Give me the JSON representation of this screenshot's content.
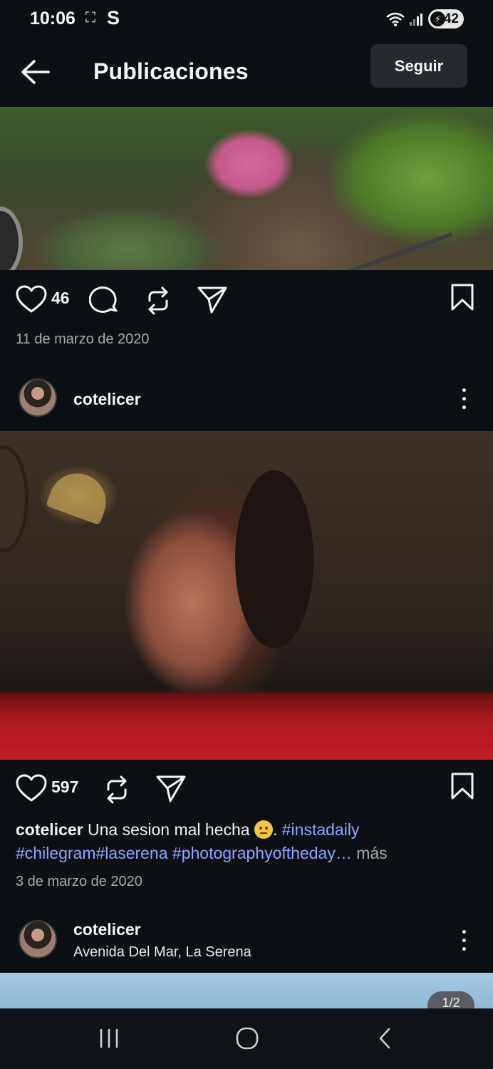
{
  "status_bar": {
    "time": "10:06",
    "screen_icon": "screen-record-icon",
    "app_icon_label": "S",
    "battery": "42"
  },
  "header": {
    "title": "Publicaciones",
    "follow_label": "Seguir"
  },
  "posts": [
    {
      "likes": "46",
      "date": "11 de marzo de 2020"
    },
    {
      "username": "cotelicer",
      "likes": "597",
      "caption_user": "cotelicer",
      "caption_text": "Una sesion mal hecha",
      "caption_after_emoji": ".",
      "tags_line1": "#instadaily",
      "tags_line2": "#chilegram#laserena #photographyoftheday…",
      "more_label": "más",
      "date": "3 de marzo de 2020"
    },
    {
      "username": "cotelicer",
      "location": "Avenida Del Mar, La Serena",
      "image_counter": "1/2"
    }
  ],
  "colors": {
    "background": "#0c1014",
    "hashtag": "#8fa3ff",
    "secondary_text": "#a8a8a8",
    "button_bg": "#262a2f"
  }
}
